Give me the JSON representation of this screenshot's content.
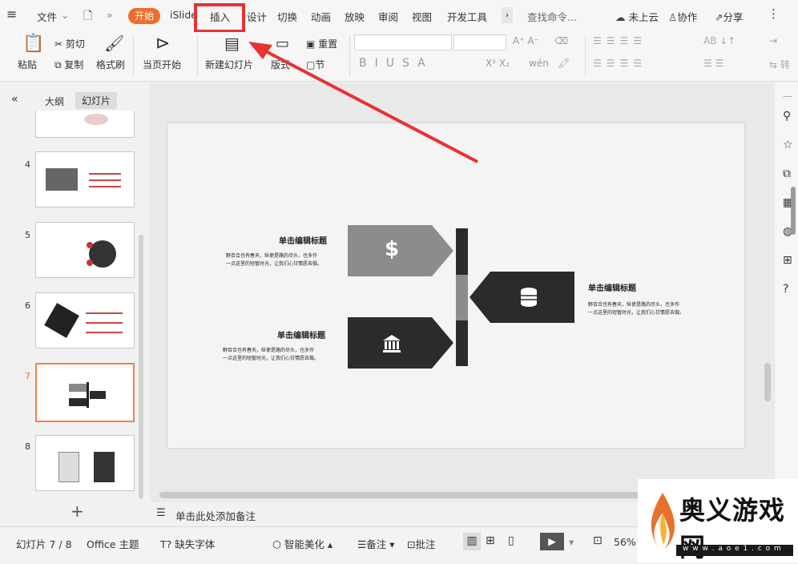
{
  "menu": {
    "file": "文件",
    "start": "开始",
    "islide": "iSlide",
    "insert": "插入",
    "design": "设计",
    "switch": "切换",
    "animation": "动画",
    "play": "放映",
    "review": "审阅",
    "view": "视图",
    "dev": "开发工具",
    "search": "查找命令...",
    "cloud": "未上云",
    "collab": "协作",
    "share": "分享"
  },
  "ribbon": {
    "paste": "粘贴",
    "cut": "剪切",
    "copy": "复制",
    "format_painter": "格式刷",
    "from_current": "当页开始",
    "new_slide": "新建幻灯片",
    "layout": "版式",
    "reset": "重置",
    "section": "节",
    "wen": "wén"
  },
  "panel": {
    "outline_tab": "大纲",
    "slides_tab": "幻灯片",
    "nums": [
      "4",
      "5",
      "6",
      "7",
      "8"
    ]
  },
  "slide": {
    "title1": "单击编辑标题",
    "desc1a": "野百合也有春天，纵使是路的尽头，也多作",
    "desc1b": "一点这里的短暂时光，让我们心甘情愿去做。",
    "title2": "单击编辑标题",
    "desc2a": "野百合也有春天，纵使是路的尽头，也多作",
    "desc2b": "一点这里的短暂时光，让我们心甘情愿去做。",
    "title3": "单击编辑标题",
    "desc3a": "野百合也有春天，纵使是路的尽头，也多作",
    "desc3b": "一点这里的短暂时光，让我们心甘情愿去做。",
    "dollar": "$"
  },
  "notes": {
    "placeholder": "单击此处添加备注"
  },
  "status": {
    "slide_count": "幻灯片 7 / 8",
    "theme": "Office 主题",
    "missing_font": "缺失字体",
    "beautify": "智能美化",
    "notes": "备注",
    "comment": "批注",
    "zoom": "56%"
  },
  "watermark": {
    "site": "奥义游戏网",
    "url": "w w w . a o e 1 . c o m"
  },
  "colors": {
    "accent": "#f06c2b",
    "highlight": "#e83232",
    "dark": "#2b2b2b",
    "gray": "#8c8c8c"
  }
}
